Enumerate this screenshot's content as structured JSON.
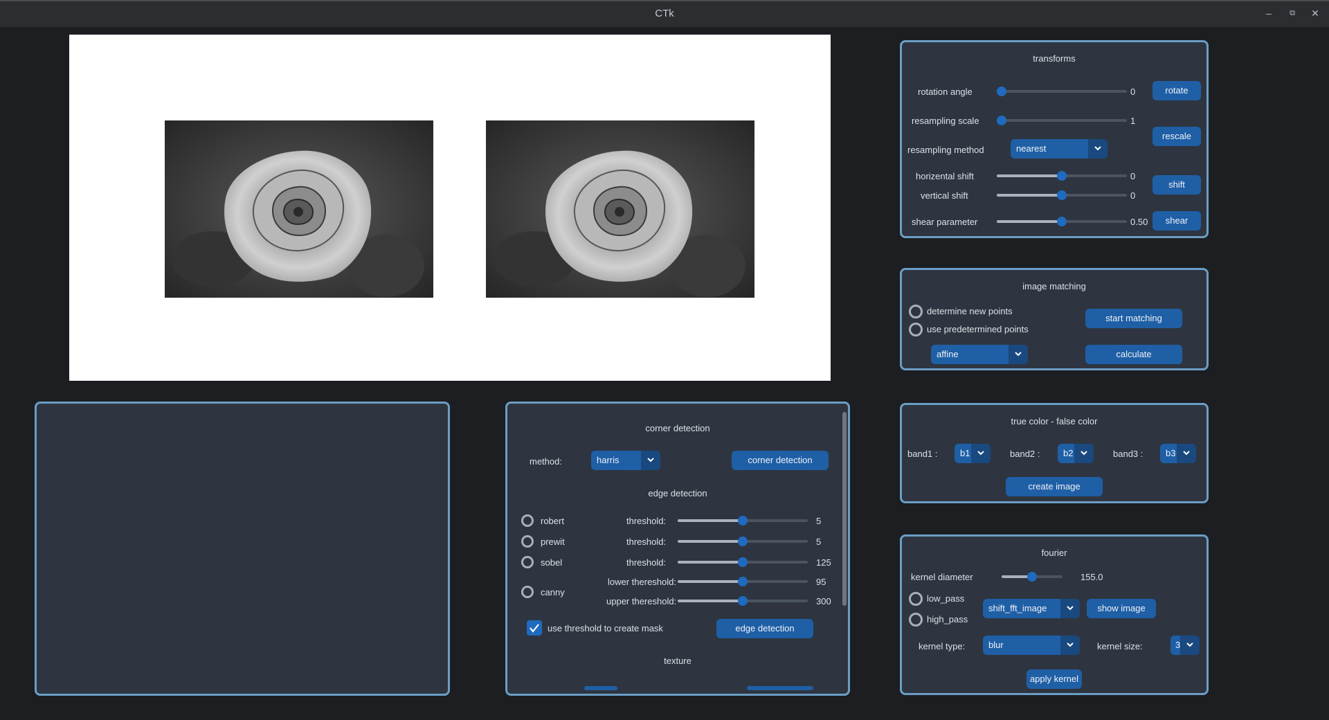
{
  "window": {
    "title": "CTk"
  },
  "transforms": {
    "title": "transforms",
    "rotation_label": "rotation angle",
    "rotation_value": "0",
    "rotation_level": 0,
    "rotate_btn": "rotate",
    "scale_label": "resampling scale",
    "scale_value": "1",
    "scale_level": 0,
    "rescale_btn": "rescale",
    "method_label": "resampling method",
    "method_value": "nearest",
    "hshift_label": "horizental shift",
    "hshift_value": "0",
    "hshift_level": 0.5,
    "vshift_label": "vertical shift",
    "vshift_value": "0",
    "vshift_level": 0.5,
    "shift_btn": "shift",
    "shear_label": "shear parameter",
    "shear_value": "0.50",
    "shear_level": 0.5,
    "shear_btn": "shear"
  },
  "matching": {
    "title": "image matching",
    "radio1": "determine new points",
    "radio2": "use predetermined points",
    "start_btn": "start matching",
    "transform_value": "affine",
    "calculate_btn": "calculate"
  },
  "color": {
    "title": "true color - false color",
    "band1_label": "band1 :",
    "band1_value": "b1",
    "band2_label": "band2 :",
    "band2_value": "b2",
    "band3_label": "band3 :",
    "band3_value": "b3",
    "create_btn": "create image"
  },
  "fourier": {
    "title": "fourier",
    "kernel_diam_label": "kernel diameter",
    "kernel_diam_value": "155.0",
    "kernel_diam_level": 0.5,
    "low_pass": "low_pass",
    "high_pass": "high_pass",
    "image_select": "shift_fft_image",
    "show_btn": "show image",
    "kernel_type_label": "kernel type:",
    "kernel_type_value": "blur",
    "kernel_size_label": "kernel size:",
    "kernel_size_value": "3",
    "apply_btn": "apply kernel"
  },
  "detection": {
    "corner_title": "corner detection",
    "method_label": "method:",
    "method_value": "harris",
    "corner_btn": "corner detection",
    "edge_title": "edge detection",
    "robert": "robert",
    "prewit": "prewit",
    "sobel": "sobel",
    "canny": "canny",
    "threshold_label": "threshold:",
    "robert_value": "5",
    "prewit_value": "5",
    "sobel_value": "125",
    "lower_label": "lower thereshold:",
    "lower_value": "95",
    "upper_label": "upper thereshold:",
    "upper_value": "300",
    "slider_level": 0.5,
    "mask_label": "use threshold to create mask",
    "edge_btn": "edge detection",
    "texture_title": "texture"
  },
  "colors": {
    "accent": "#1f5fa6",
    "frame_border": "#6b9ec6",
    "panel_bg": "#2e3540",
    "app_bg": "#1c1e21"
  }
}
